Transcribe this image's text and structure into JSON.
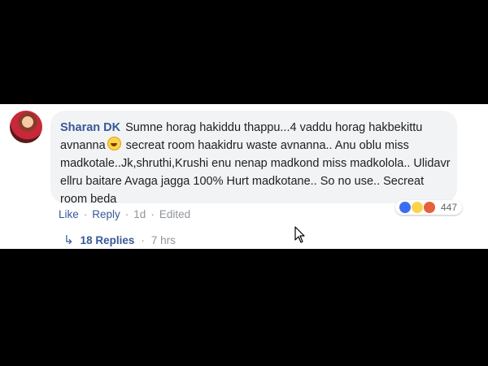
{
  "comment": {
    "author": "Sharan DK",
    "text_before_emoji": "Sumne horag hakiddu thappu...4 vaddu horag hakbekittu avnanna",
    "text_after_emoji": " secreat room haakidru waste avnanna.. Anu oblu miss madkotale..Jk,shruthi,Krushi enu nenap madkond miss madkolola.. Ulidavr ellru baitare Avaga jagga 100% Hurt madkotane.. So no use.. Secreat room beda",
    "emoji": "laughing-emoji"
  },
  "reactions": {
    "icons": [
      "like-icon",
      "haha-icon",
      "angry-icon"
    ],
    "count": "447"
  },
  "actions": {
    "like": "Like",
    "reply": "Reply",
    "time": "1d",
    "edited": "Edited"
  },
  "replies": {
    "label": "18 Replies",
    "time": "7 hrs"
  },
  "colors": {
    "link": "#385898",
    "bubble": "#f2f3f5",
    "muted": "#90949c",
    "background": "#000000"
  }
}
